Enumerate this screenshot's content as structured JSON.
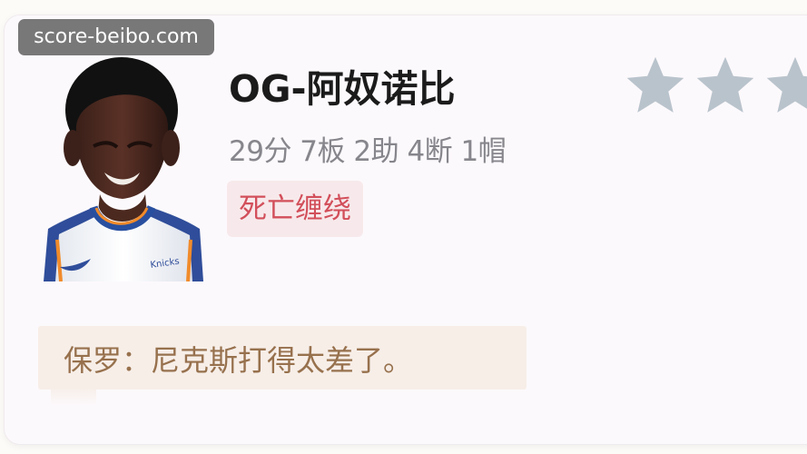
{
  "watermark": {
    "text": "score-beibo.com"
  },
  "player": {
    "name": "OG-阿奴诺比",
    "stats": "29分 7板 2助 4断 1帽",
    "tag": "死亡缠绕",
    "rating": {
      "visible_stars": 3,
      "star_color": "#b9c3cc"
    },
    "avatar_icon": "player-headshot"
  },
  "comment": {
    "text": "保罗：尼克斯打得太差了。"
  },
  "colors": {
    "tag_bg": "#f7e9eb",
    "tag_text": "#d24f5a",
    "quote_bg": "#f7eee8",
    "quote_text": "#97714d",
    "name_text": "#1b1b1b",
    "stats_text": "#86868c"
  }
}
